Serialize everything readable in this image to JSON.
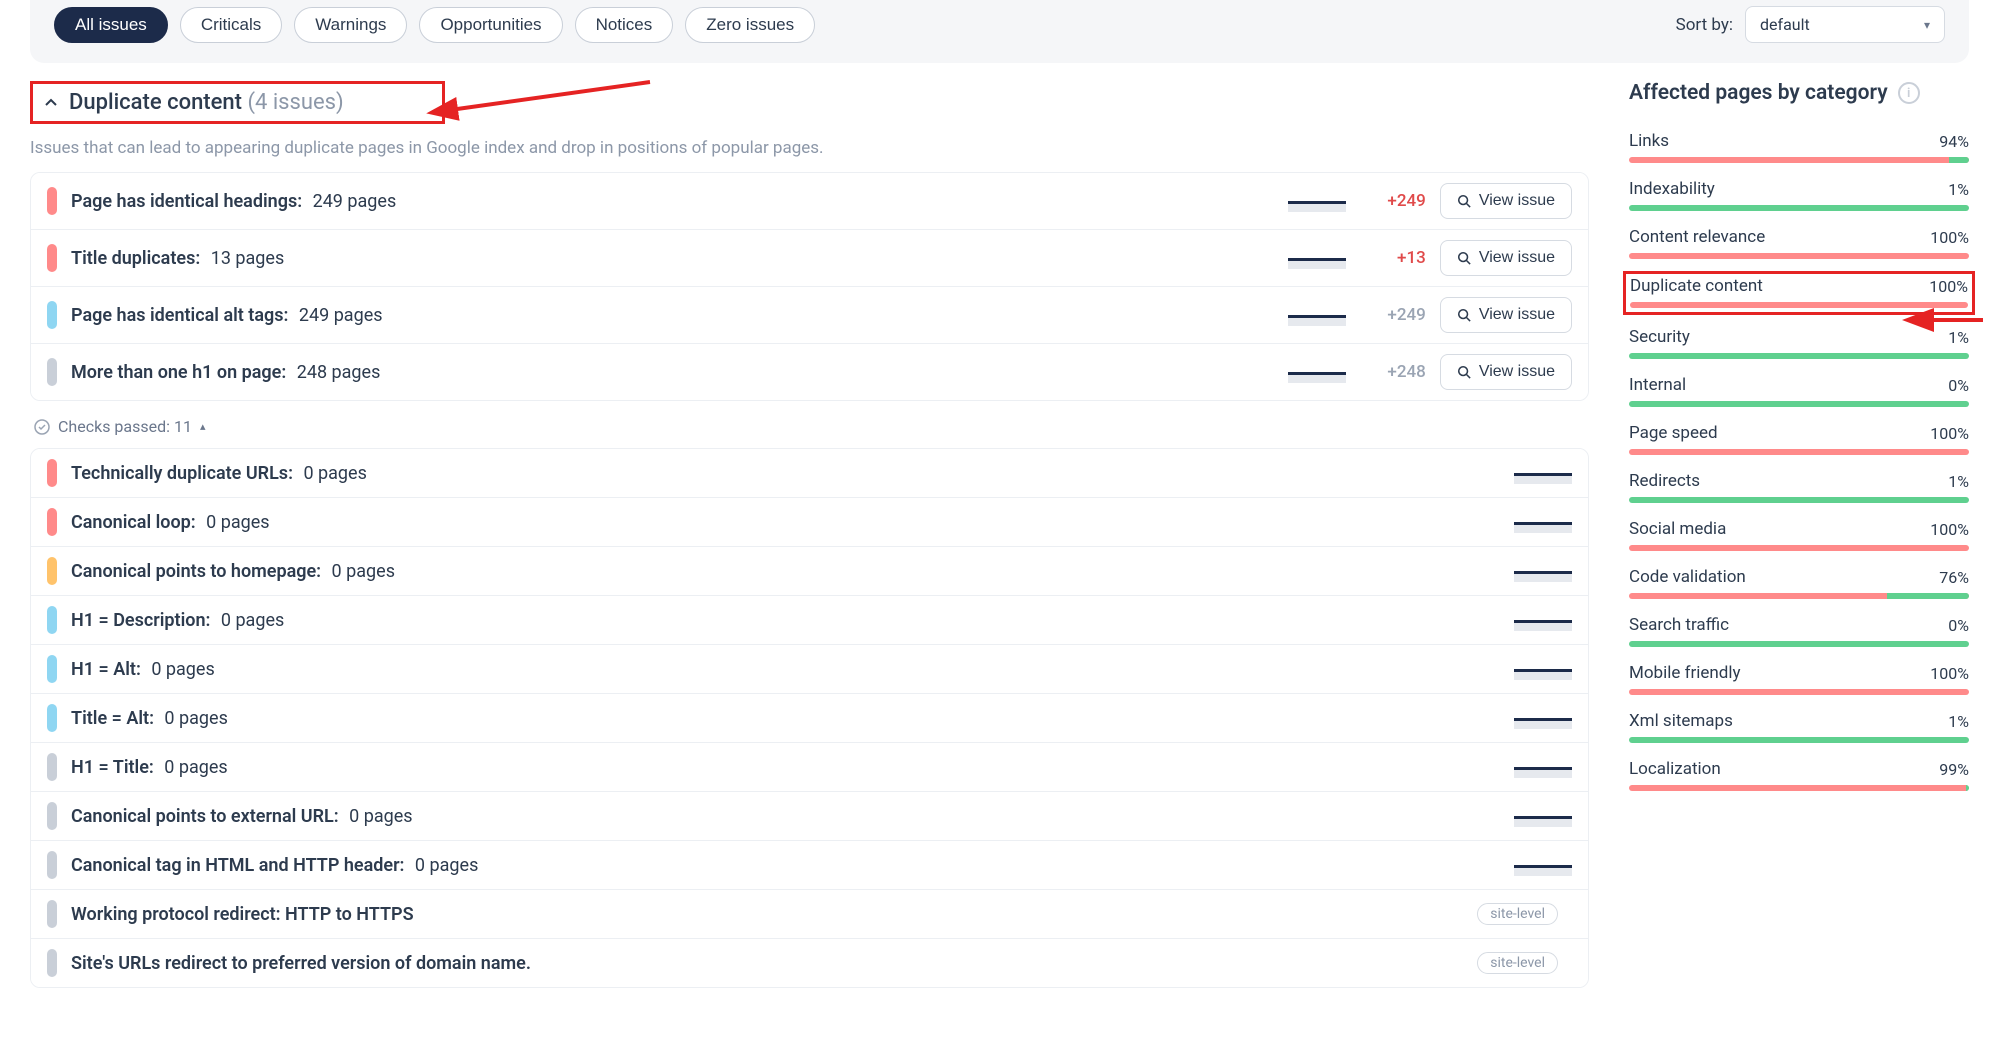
{
  "filters": {
    "tabs": [
      "All issues",
      "Criticals",
      "Warnings",
      "Opportunities",
      "Notices",
      "Zero issues"
    ],
    "active_index": 0,
    "sort_label": "Sort by:",
    "sort_value": "default"
  },
  "section": {
    "title": "Duplicate content",
    "issues_suffix": "(4 issues)",
    "description": "Issues that can lead to appearing duplicate pages in Google index and drop in positions of popular pages."
  },
  "issues": [
    {
      "sev": "red",
      "title": "Page has identical headings:",
      "count": "249 pages",
      "delta": "+249",
      "delta_style": "pos",
      "view": "View issue"
    },
    {
      "sev": "red",
      "title": "Title duplicates:",
      "count": "13 pages",
      "delta": "+13",
      "delta_style": "pos",
      "view": "View issue"
    },
    {
      "sev": "blue",
      "title": "Page has identical alt tags:",
      "count": "249 pages",
      "delta": "+249",
      "delta_style": "grey",
      "view": "View issue"
    },
    {
      "sev": "grey",
      "title": "More than one h1 on page:",
      "count": "248 pages",
      "delta": "+248",
      "delta_style": "grey",
      "view": "View issue"
    }
  ],
  "checks_passed_label": "Checks passed: 11",
  "passed": [
    {
      "sev": "red",
      "title": "Technically duplicate URLs:",
      "count": "0 pages"
    },
    {
      "sev": "red",
      "title": "Canonical loop:",
      "count": "0 pages"
    },
    {
      "sev": "orange",
      "title": "Canonical points to homepage:",
      "count": "0 pages"
    },
    {
      "sev": "blue",
      "title": "H1 = Description:",
      "count": "0 pages"
    },
    {
      "sev": "blue",
      "title": "H1 = Alt:",
      "count": "0 pages"
    },
    {
      "sev": "blue",
      "title": "Title = Alt:",
      "count": "0 pages"
    },
    {
      "sev": "grey",
      "title": "H1 = Title:",
      "count": "0 pages"
    },
    {
      "sev": "grey",
      "title": "Canonical points to external URL:",
      "count": "0 pages"
    },
    {
      "sev": "grey",
      "title": "Canonical tag in HTML and HTTP header:",
      "count": "0 pages"
    },
    {
      "sev": "grey",
      "title": "Working protocol redirect: HTTP to HTTPS",
      "badge": "site-level"
    },
    {
      "sev": "grey",
      "title": "Site's URLs redirect to preferred version of domain name.",
      "badge": "site-level"
    }
  ],
  "side": {
    "title": "Affected pages by category",
    "categories": [
      {
        "name": "Links",
        "pct": "94%",
        "green_start_pct": 94,
        "highlight": false
      },
      {
        "name": "Indexability",
        "pct": "1%",
        "green_start_pct": 1,
        "highlight": false,
        "all_green_bar": true
      },
      {
        "name": "Content relevance",
        "pct": "100%",
        "green_start_pct": 100,
        "highlight": false
      },
      {
        "name": "Duplicate content",
        "pct": "100%",
        "green_start_pct": 100,
        "highlight": true
      },
      {
        "name": "Security",
        "pct": "1%",
        "green_start_pct": 1,
        "highlight": false,
        "all_green_bar": true
      },
      {
        "name": "Internal",
        "pct": "0%",
        "green_start_pct": 0,
        "highlight": false,
        "all_green_bar": true
      },
      {
        "name": "Page speed",
        "pct": "100%",
        "green_start_pct": 100,
        "highlight": false
      },
      {
        "name": "Redirects",
        "pct": "1%",
        "green_start_pct": 1,
        "highlight": false,
        "all_green_bar": true
      },
      {
        "name": "Social media",
        "pct": "100%",
        "green_start_pct": 100,
        "highlight": false
      },
      {
        "name": "Code validation",
        "pct": "76%",
        "green_start_pct": 76,
        "highlight": false
      },
      {
        "name": "Search traffic",
        "pct": "0%",
        "green_start_pct": 0,
        "highlight": false,
        "all_green_bar": true
      },
      {
        "name": "Mobile friendly",
        "pct": "100%",
        "green_start_pct": 100,
        "highlight": false
      },
      {
        "name": "Xml sitemaps",
        "pct": "1%",
        "green_start_pct": 1,
        "highlight": false,
        "all_green_bar": true
      },
      {
        "name": "Localization",
        "pct": "99%",
        "green_start_pct": 99,
        "highlight": false
      }
    ]
  },
  "labels": {
    "view_issue": "View issue"
  }
}
